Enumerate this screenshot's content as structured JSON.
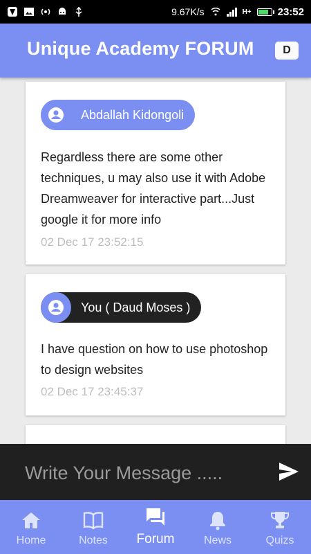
{
  "status_bar": {
    "speed": "9.67K/s",
    "time": "23:52",
    "network": "H+",
    "battery_level": 0.85
  },
  "app_bar": {
    "title": "Unique Academy FORUM",
    "user_initial": "D"
  },
  "messages": [
    {
      "author": "Abdallah Kidongoli",
      "text": "Regardless there are some other techniques, u may also use it with Adobe Dreamweaver for interactive part...Just google it for more info",
      "timestamp": "02 Dec 17 23:52:15",
      "is_self": false
    },
    {
      "author": "You ( Daud Moses )",
      "text": "I have question on how to use photoshop to design websites",
      "timestamp": "02 Dec 17 23:45:37",
      "is_self": true
    }
  ],
  "composer": {
    "placeholder": "Write Your Message ....."
  },
  "bottom_nav": {
    "items": [
      {
        "label": "Home",
        "icon": "home-icon"
      },
      {
        "label": "Notes",
        "icon": "book-icon"
      },
      {
        "label": "Forum",
        "icon": "forum-icon",
        "active": true
      },
      {
        "label": "News",
        "icon": "bell-icon"
      },
      {
        "label": "Quizs",
        "icon": "trophy-icon"
      }
    ]
  },
  "colors": {
    "primary": "#7b8ff2",
    "self_pill": "#222222",
    "composer_bg": "#202020",
    "timestamp": "#bdbdbd"
  }
}
